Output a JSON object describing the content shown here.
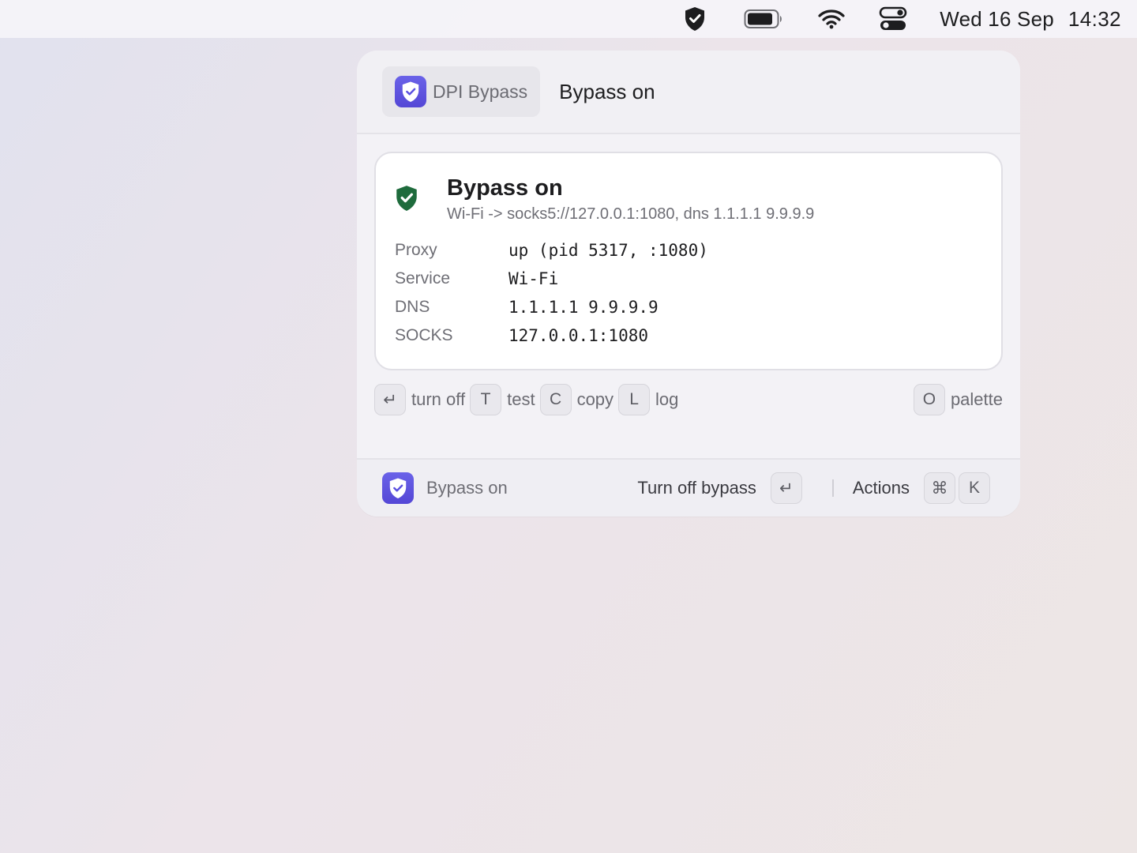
{
  "menubar": {
    "icons": [
      "shield-check-icon",
      "battery-icon",
      "wifi-icon",
      "control-center-icon"
    ],
    "date": "Wed 16 Sep",
    "time": "14:32"
  },
  "header": {
    "extension_name": "DPI Bypass",
    "search_text": "Bypass on"
  },
  "card": {
    "title": "Bypass on",
    "subtitle": "Wi-Fi -> socks5://127.0.0.1:1080, dns 1.1.1.1 9.9.9.9",
    "rows": [
      {
        "key": "Proxy",
        "value": "up (pid 5317, :1080)"
      },
      {
        "key": "Service",
        "value": "Wi-Fi"
      },
      {
        "key": "DNS",
        "value": "1.1.1.1 9.9.9.9"
      },
      {
        "key": "SOCKS",
        "value": "127.0.0.1:1080"
      }
    ]
  },
  "hints": {
    "turn_off_key": "↵",
    "turn_off_label": "turn off",
    "test_key": "T",
    "test_label": "test",
    "copy_key": "C",
    "copy_label": "copy",
    "log_key": "L",
    "log_label": "log",
    "palette_key": "O",
    "palette_label": "palette"
  },
  "footer": {
    "status": "Bypass on",
    "primary_action": "Turn off bypass",
    "primary_key": "↵",
    "actions_label": "Actions",
    "actions_key_1": "⌘",
    "actions_key_2": "K"
  },
  "colors": {
    "accent": "#5a4fe0",
    "status_green": "#1e6b3c"
  }
}
